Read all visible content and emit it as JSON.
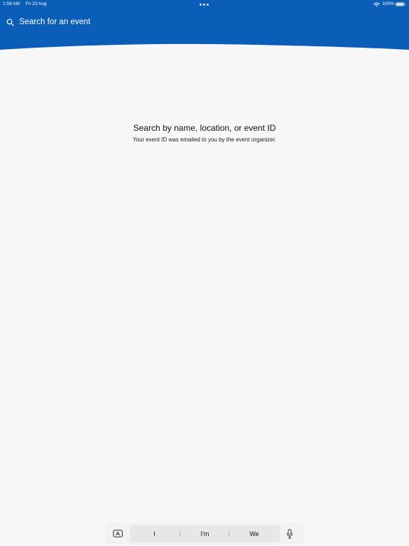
{
  "status_bar": {
    "time": "1:59 AM",
    "date": "Fri 23 Aug",
    "battery": "100%",
    "icons": {
      "multitasking": "more-dots-icon",
      "wifi": "wifi-icon",
      "battery": "battery-icon"
    }
  },
  "header": {
    "search_placeholder": "Search for an event",
    "search_icon": "search-icon",
    "background_color": "#0a5eb8"
  },
  "empty_state": {
    "title": "Search by name, location, or event ID",
    "subtitle": "Your event ID was emailed to you by the event organizer."
  },
  "keyboard_bar": {
    "toggle_icon": "keyboard-toggle-icon",
    "suggestions": [
      "I",
      "I'm",
      "We"
    ],
    "microphone_icon": "microphone-icon"
  },
  "colors": {
    "accent": "#0a5eb8",
    "page_background": "#f7f7f7",
    "text": "#111111"
  }
}
